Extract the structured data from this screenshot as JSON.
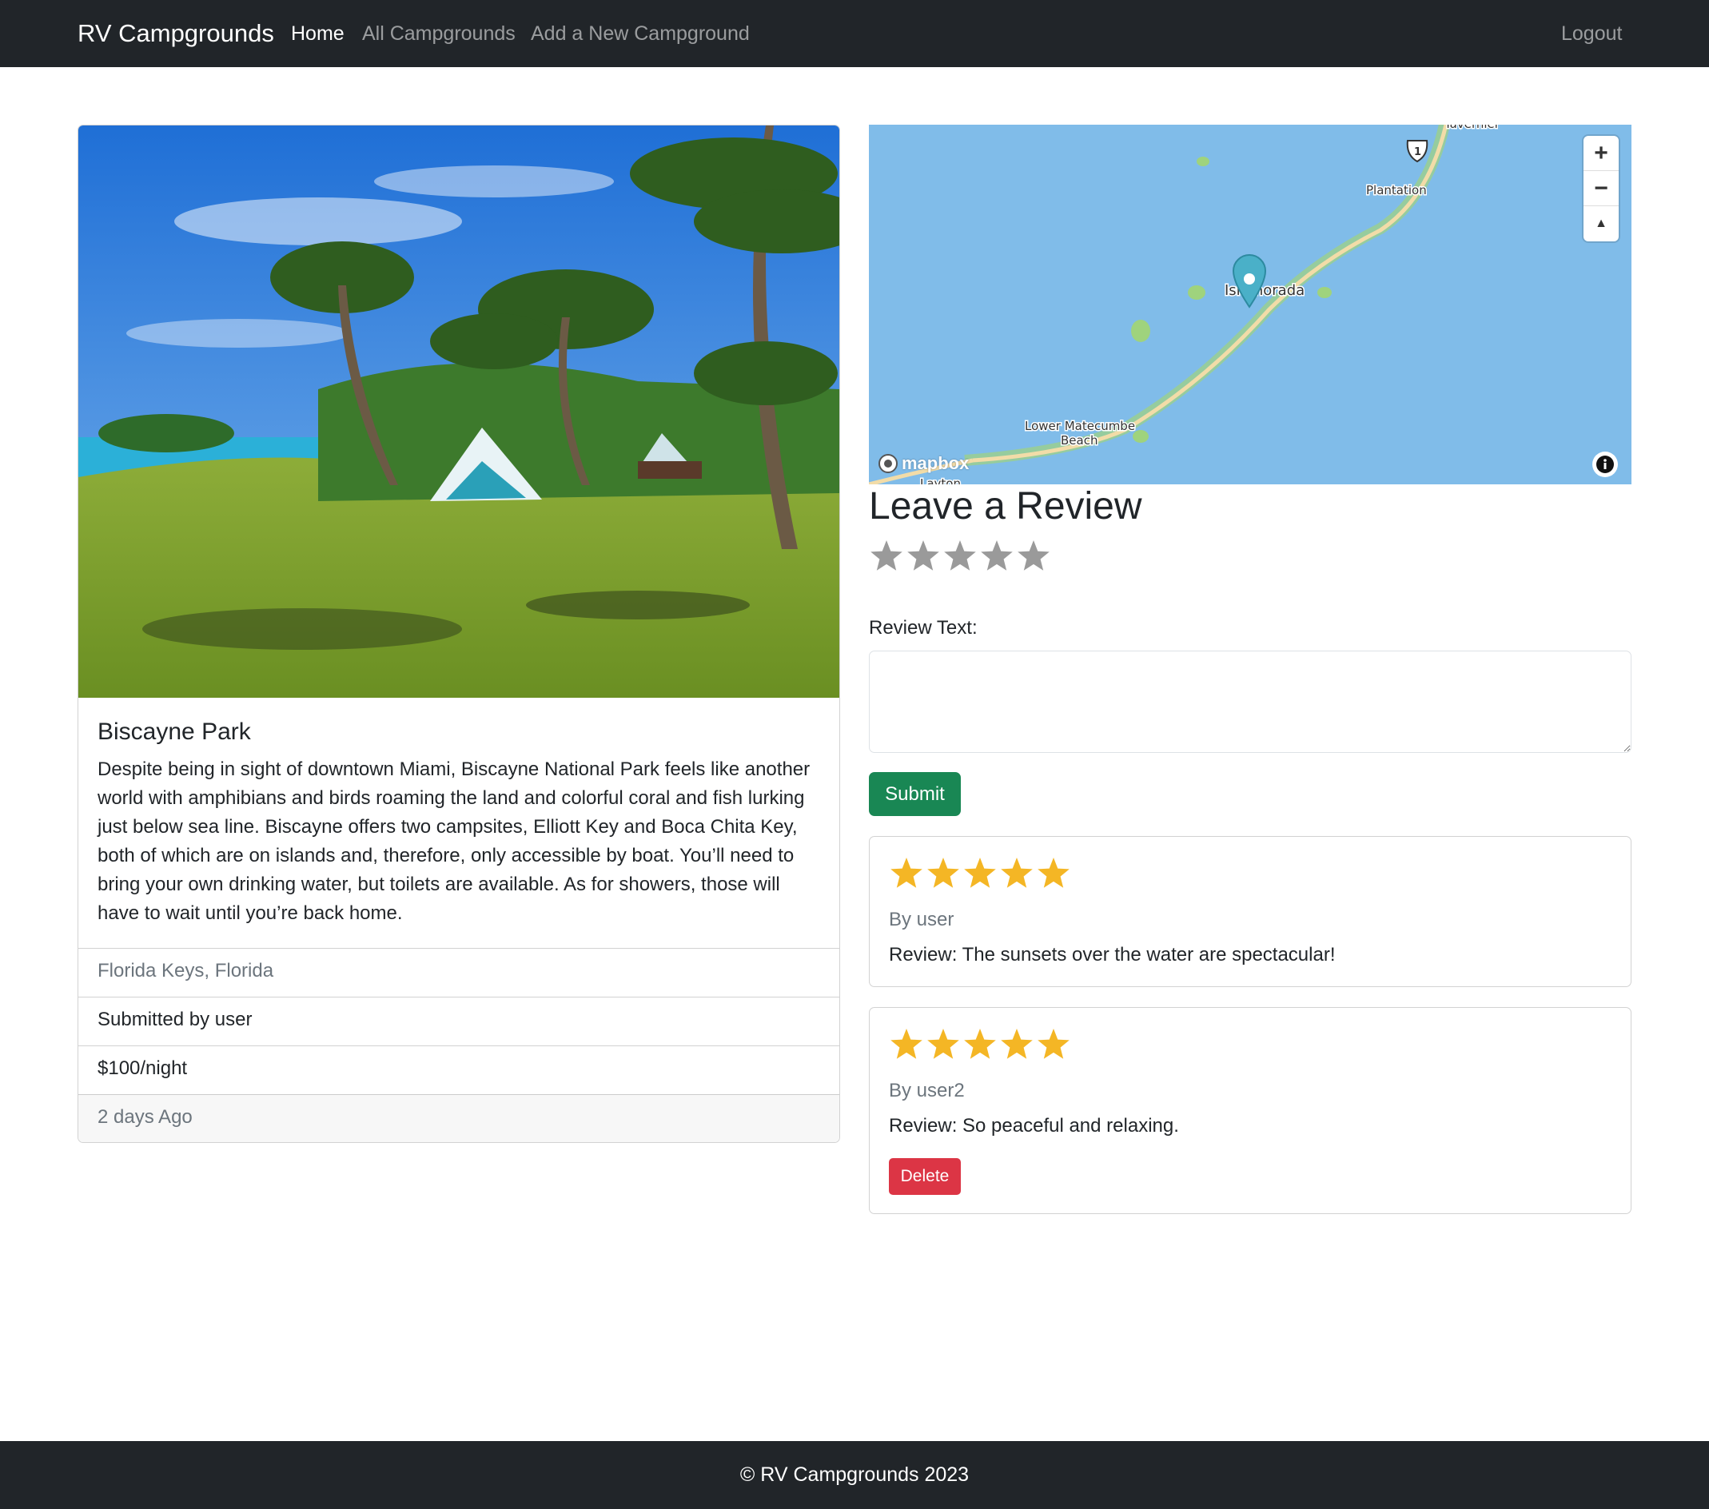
{
  "navbar": {
    "brand": "RV Campgrounds",
    "links": [
      {
        "label": "Home",
        "active": true
      },
      {
        "label": "All Campgrounds",
        "active": false
      },
      {
        "label": "Add a New Campground",
        "active": false
      }
    ],
    "logout": "Logout"
  },
  "campground": {
    "title": "Biscayne Park",
    "description": "Despite being in sight of downtown Miami, Biscayne National Park feels like another world with amphibians and birds roaming the land and colorful coral and fish lurking just below sea line. Biscayne offers two campsites, Elliott Key and Boca Chita Key, both of which are on islands and, therefore, only accessible by boat. You’ll need to bring your own drinking water, but toilets are available. As for showers, those will have to wait until you’re back home.",
    "location": "Florida Keys, Florida",
    "submitted_by": "Submitted by user",
    "price": "$100/night",
    "posted": "2 days Ago",
    "image_icon": "campground-photo"
  },
  "map": {
    "places": {
      "tavernier": "Tavernier",
      "plantation": "Plantation",
      "islamorada": "Islamorada",
      "lower_matecumbe_1": "Lower Matecumbe",
      "lower_matecumbe_2": "Beach",
      "layton": "Layton"
    },
    "shield": "1",
    "logo": "mapbox",
    "zoom_in": "+",
    "zoom_out": "−",
    "compass": "▲",
    "info_icon": "info-icon"
  },
  "review_form": {
    "heading": "Leave a Review",
    "rating": 0,
    "label": "Review Text:",
    "textarea_value": "",
    "submit": "Submit"
  },
  "reviews": [
    {
      "rating": 5,
      "author": "By user",
      "body": "Review: The sunsets over the water are spectacular!",
      "delete": ""
    },
    {
      "rating": 5,
      "author": "By user2",
      "body": "Review: So peaceful and relaxing.",
      "delete": "Delete"
    }
  ],
  "footer": {
    "text": "© RV Campgrounds 2023"
  },
  "colors": {
    "navbar_bg": "#212529",
    "success": "#198754",
    "danger": "#dc3545",
    "star_filled": "#f4b625",
    "star_empty": "#9a9a9a",
    "water": "#80bce9"
  }
}
